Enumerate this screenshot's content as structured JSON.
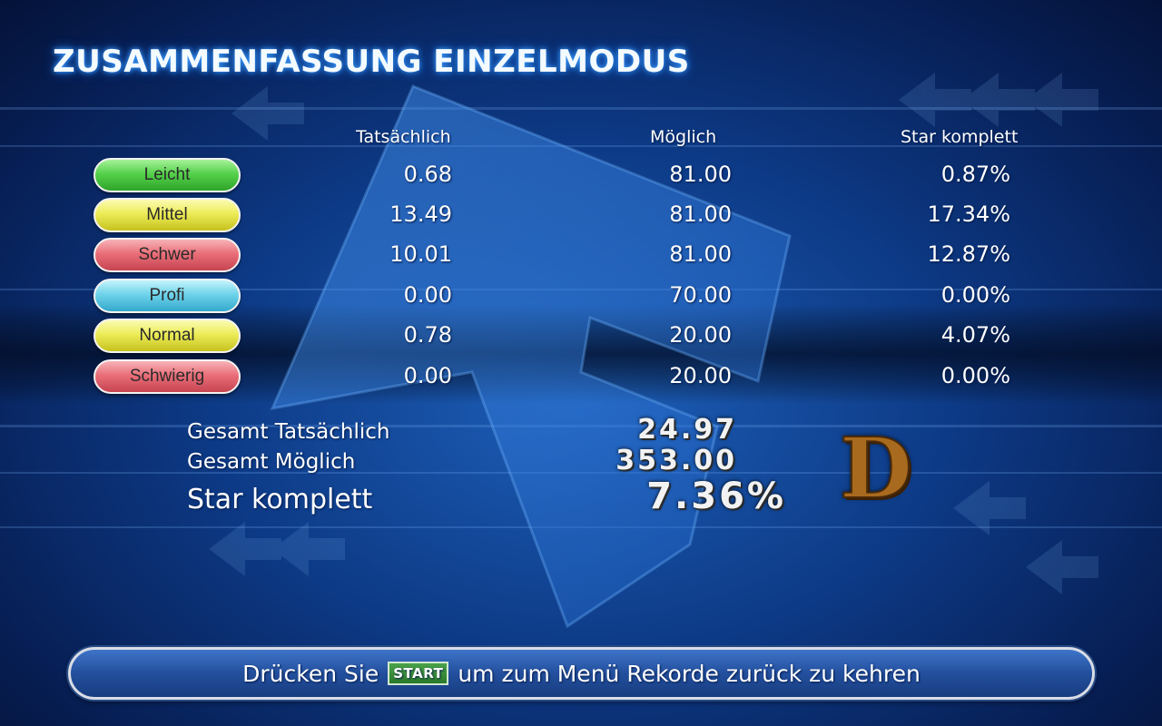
{
  "screen": {
    "title": "ZUSAMMENFASSUNG EINZELMODUS",
    "columns": {
      "actual": "Tatsächlich",
      "possible": "Möglich",
      "star": "Star komplett"
    }
  },
  "rows": [
    {
      "label": "Leicht",
      "color": "green",
      "actual": "0.68",
      "possible": "81.00",
      "star": "0.87%"
    },
    {
      "label": "Mittel",
      "color": "yellow",
      "actual": "13.49",
      "possible": "81.00",
      "star": "17.34%"
    },
    {
      "label": "Schwer",
      "color": "red",
      "actual": "10.01",
      "possible": "81.00",
      "star": "12.87%"
    },
    {
      "label": "Profi",
      "color": "cyan",
      "actual": "0.00",
      "possible": "70.00",
      "star": "0.00%"
    },
    {
      "label": "Normal",
      "color": "yellow",
      "actual": "0.78",
      "possible": "20.00",
      "star": "4.07%"
    },
    {
      "label": "Schwierig",
      "color": "red",
      "actual": "0.00",
      "possible": "20.00",
      "star": "0.00%"
    }
  ],
  "totals": {
    "actual_label": "Gesamt Tatsächlich",
    "actual_value": "24.97",
    "possible_label": "Gesamt Möglich",
    "possible_value": "353.00",
    "star_label": "Star komplett",
    "star_value": "7.36%"
  },
  "rank": "D",
  "footer": {
    "prefix": "Drücken Sie",
    "button": "START",
    "suffix": "um zum Menü Rekorde zurück zu kehren"
  },
  "colors": {
    "background": "#0d3a86",
    "rank": "#a86a1e",
    "footer": "#234f9d"
  }
}
